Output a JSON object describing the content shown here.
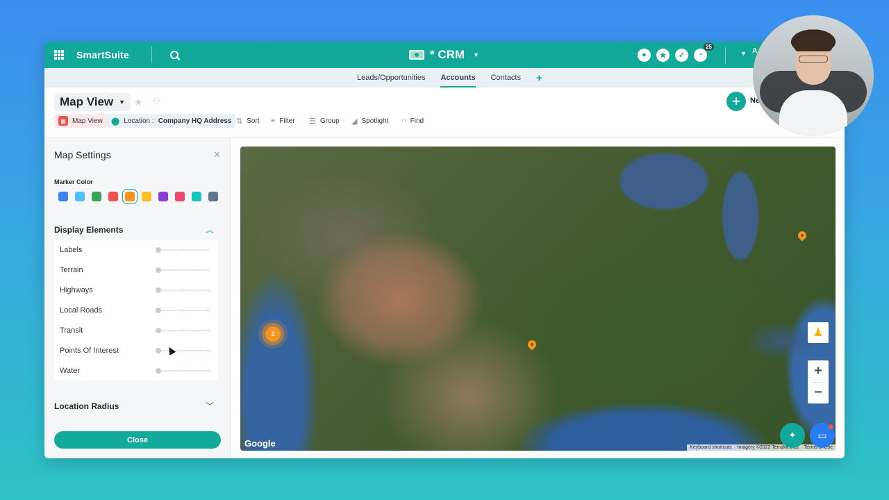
{
  "header": {
    "brand": "SmartSuite",
    "app_title": "* CRM",
    "notifications_count": "25",
    "account_initial": "A"
  },
  "tabs": [
    {
      "label": "Leads/Opportunities",
      "active": false
    },
    {
      "label": "Accounts",
      "active": true
    },
    {
      "label": "Contacts",
      "active": false
    }
  ],
  "view": {
    "title": "Map View",
    "new_button_label": "Ne"
  },
  "toolbar": {
    "map_view": "Map View",
    "location_prefix": "Location : ",
    "location_field": "Company HQ Address",
    "sort": "Sort",
    "filter": "Filter",
    "group": "Group",
    "spotlight": "Spotlight",
    "find": "Find"
  },
  "settings": {
    "title": "Map Settings",
    "marker_color_label": "Marker Color",
    "marker_colors": [
      "#3b82f6",
      "#4fc3f7",
      "#3aa655",
      "#ef5350",
      "#f7941d",
      "#fbbf24",
      "#8b3fd1",
      "#ec4a6c",
      "#17c3c0",
      "#5e7891"
    ],
    "selected_color_index": 4,
    "display_elements_title": "Display Elements",
    "display_elements": [
      "Labels",
      "Terrain",
      "Highways",
      "Local Roads",
      "Transit",
      "Points Of Interest",
      "Water"
    ],
    "location_radius_title": "Location Radius",
    "close_label": "Close"
  },
  "map": {
    "cluster_count": "2",
    "google_label": "Google",
    "attribution": {
      "keyboard": "Keyboard shortcuts",
      "imagery": "Imagery ©2023 TerraMetrics",
      "terms": "Terms of Use"
    },
    "zoom_in": "+",
    "zoom_out": "−"
  },
  "colors": {
    "accent": "#12a99a",
    "marker": "#f7941d"
  }
}
